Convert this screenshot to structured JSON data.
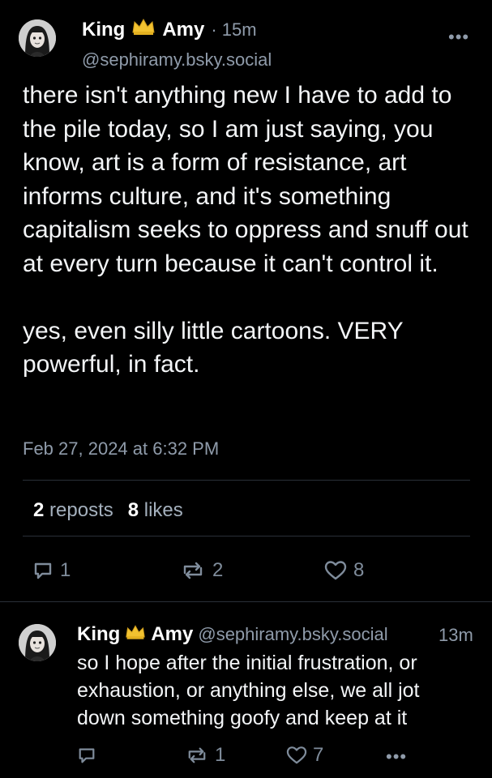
{
  "post": {
    "author_first": "King",
    "author_last": "Amy",
    "time": "· 15m",
    "handle": "@sephiramy.bsky.social",
    "more_label": "•••",
    "text": "there isn't anything new I have to add to the pile today, so I am just saying, you know, art is a form of resistance, art informs culture, and it's something capitalism seeks to oppress and snuff out at every turn because it can't control it.\n\nyes, even silly little cartoons. VERY powerful, in fact.",
    "date": "Feb 27, 2024 at 6:32 PM",
    "reposts_count": "2",
    "reposts_label": "reposts",
    "likes_count": "8",
    "likes_label": "likes",
    "actions": {
      "reply_count": "1",
      "repost_count": "2",
      "like_count": "8"
    }
  },
  "reply": {
    "author_first": "King",
    "author_last": "Amy",
    "handle": "@sephiramy.bsky.social",
    "time": "13m",
    "text": "so I hope after the initial frustration, or\nexhaustion, or anything else, we all jot\ndown something goofy and keep at it",
    "actions": {
      "repost_count": "1",
      "like_count": "7"
    },
    "more_label": "•••"
  },
  "colors": {
    "background": "#000000",
    "muted": "#8f9baa",
    "divider": "#2a3038",
    "crown": "#f2c230"
  },
  "icons": [
    "crown-icon",
    "reply-icon",
    "repost-icon",
    "like-icon",
    "more-icon"
  ]
}
